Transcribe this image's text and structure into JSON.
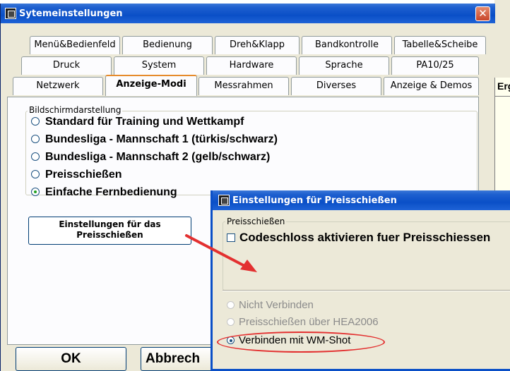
{
  "main_window": {
    "title": "Sytemeinstellungen",
    "close_symbol": "✕",
    "tabs_row1": [
      "Menü&Bedienfeld",
      "Bedienung",
      "Dreh&Klapp",
      "Bandkontrolle",
      "Tabelle&Scheibe"
    ],
    "tabs_row2": [
      "Druck",
      "System",
      "Hardware",
      "Sprache",
      "PA10/25"
    ],
    "tabs_row3": [
      "Netzwerk",
      "Anzeige-Modi",
      "Messrahmen",
      "Diverses",
      "Anzeige & Demos"
    ],
    "active_tab": "Anzeige-Modi",
    "groupbox_label": "Bildschirmdarstellung",
    "display_modes": [
      {
        "label": "Standard für Training und Wettkampf",
        "checked": false
      },
      {
        "label": "Bundesliga - Mannschaft 1 (türkis/schwarz)",
        "checked": false
      },
      {
        "label": "Bundesliga - Mannschaft 2 (gelb/schwarz)",
        "checked": false
      },
      {
        "label": "Preisschießen",
        "checked": false
      },
      {
        "label": "Einfache Fernbedienung",
        "checked": true
      }
    ],
    "settings_button_label_line1": "Einstellungen für das",
    "settings_button_label_line2": "Preisschießen",
    "ok_label": "OK",
    "cancel_label": "Abbrech"
  },
  "background_window": {
    "erg_label": "Erg"
  },
  "popup": {
    "title": "Einstellungen für Preisschießen",
    "group_label": "Preisschießen",
    "codeschloss_label": "Codeschloss aktivieren fuer Preisschiessen",
    "codeschloss_checked": false,
    "connection_options": [
      {
        "label": "Nicht Verbinden",
        "checked": false,
        "disabled": true
      },
      {
        "label": "Preisschießen über HEA2006",
        "checked": false,
        "disabled": true
      },
      {
        "label": "Verbinden mit WM-Shot",
        "checked": true,
        "disabled": false
      }
    ]
  },
  "annotation": {
    "arrow_color": "#e33030",
    "highlight_color": "#e33030"
  },
  "colors": {
    "titlebar_blue": "#0a4fc7",
    "window_face": "#ece9d8",
    "tab_face": "#fcfcfe",
    "active_tab_accent": "#e68b2c"
  }
}
